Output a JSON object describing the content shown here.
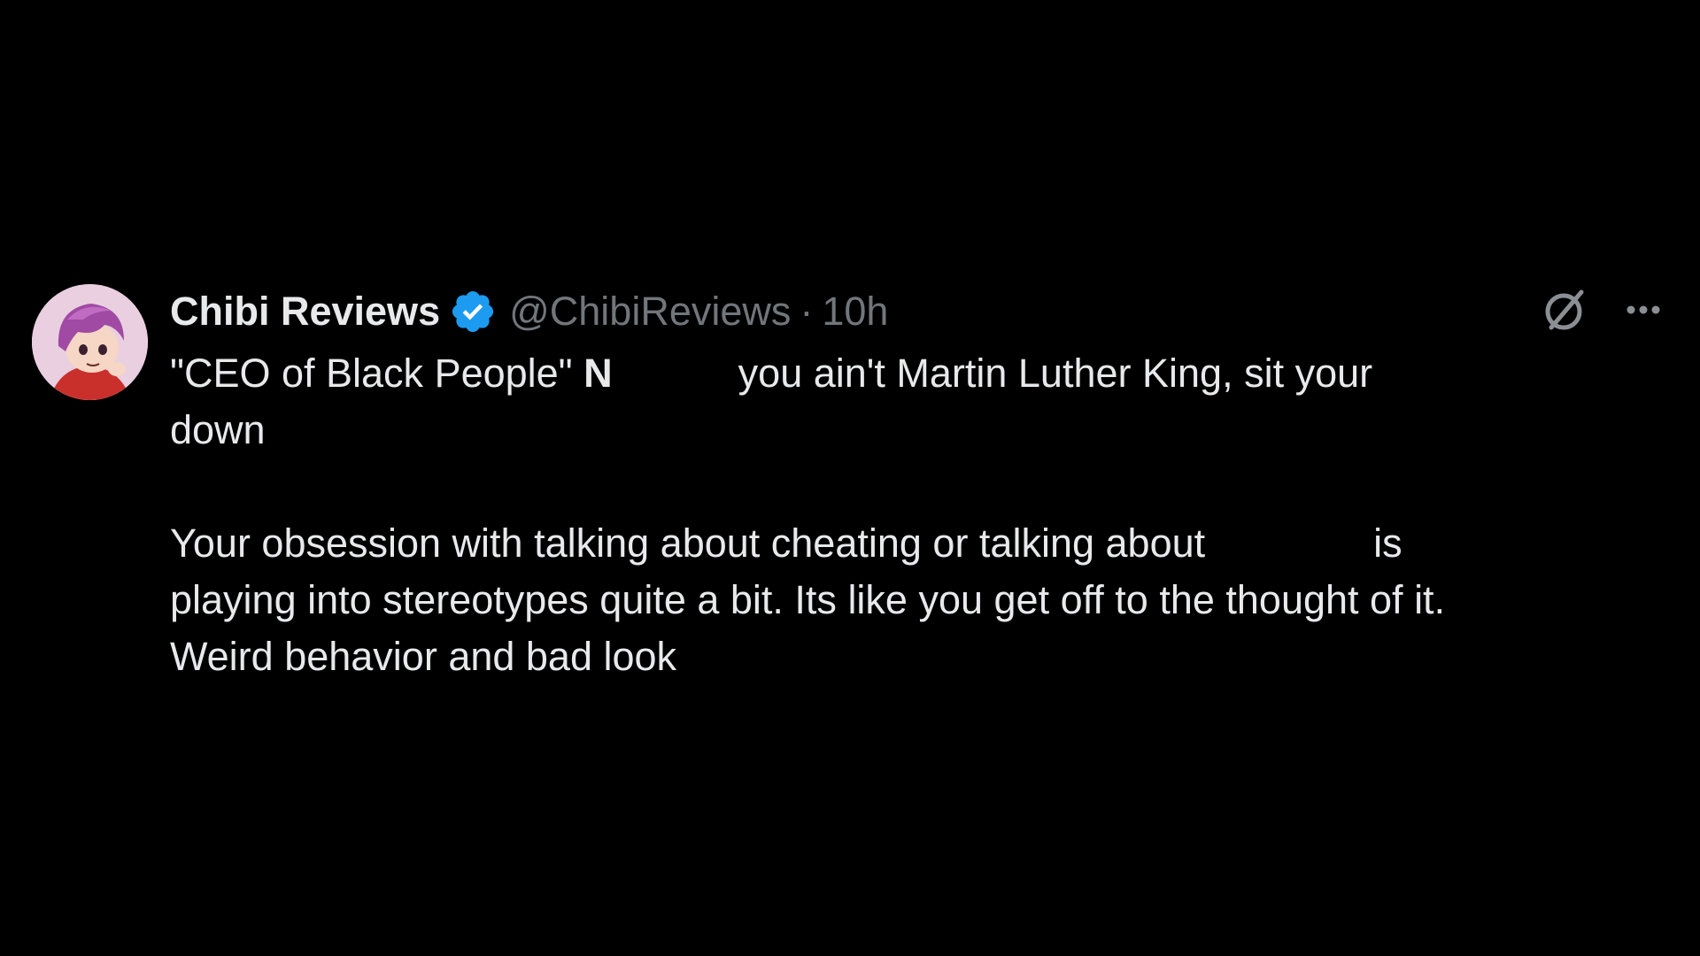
{
  "tweet": {
    "display_name": "Chibi Reviews",
    "handle": "@ChibiReviews",
    "separator": "·",
    "time": "10h",
    "icons": {
      "verified": "verified-badge-icon",
      "grok": "grok-icon",
      "more": "more-options-icon"
    },
    "accent_color": "#1d9bf0",
    "body": {
      "line1_a": "\"CEO of Black People\" ",
      "line1_n": "N",
      "line1_b": "you ain't  Martin Luther King, sit your",
      "line2": "down",
      "line3_a": "Your obsession with talking about cheating or talking about",
      "line3_b": "is",
      "line4": "playing into stereotypes quite a bit. Its like you get off to the thought of it.",
      "line5": "Weird behavior and bad look"
    }
  }
}
